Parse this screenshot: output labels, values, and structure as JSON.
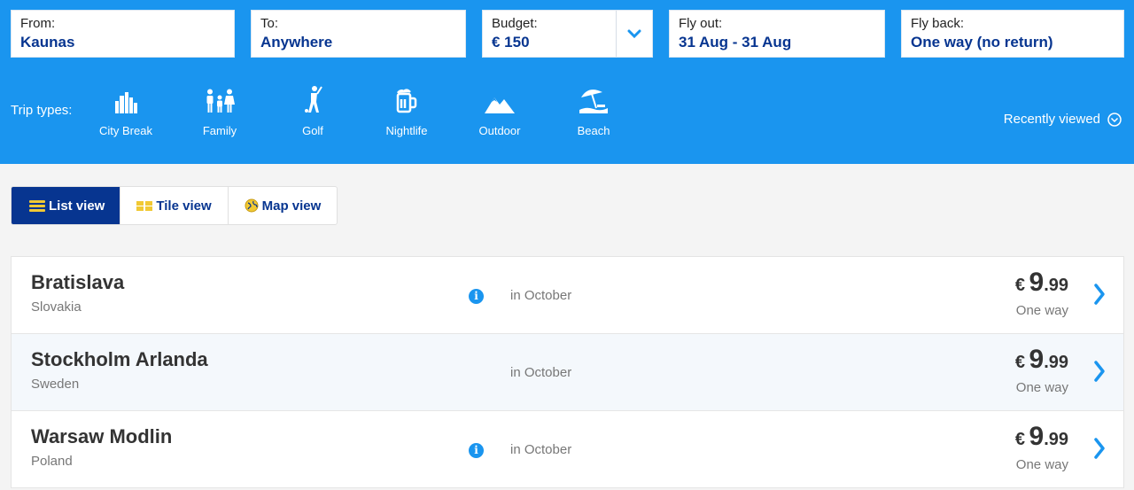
{
  "search": {
    "from": {
      "label": "From:",
      "value": "Kaunas"
    },
    "to": {
      "label": "To:",
      "value": "Anywhere"
    },
    "budget": {
      "label": "Budget:",
      "value": "€ 150"
    },
    "fly_out": {
      "label": "Fly out:",
      "value": "31 Aug - 31 Aug"
    },
    "fly_back": {
      "label": "Fly back:",
      "value": "One way (no return)"
    }
  },
  "trip_types": {
    "label": "Trip types:",
    "items": [
      {
        "label": "City Break",
        "icon": "city-icon"
      },
      {
        "label": "Family",
        "icon": "family-icon"
      },
      {
        "label": "Golf",
        "icon": "golf-icon"
      },
      {
        "label": "Nightlife",
        "icon": "beer-icon"
      },
      {
        "label": "Outdoor",
        "icon": "mountain-icon"
      },
      {
        "label": "Beach",
        "icon": "beach-umbrella-icon"
      }
    ]
  },
  "recently_viewed": "Recently viewed",
  "views": {
    "list": "List view",
    "tile": "Tile view",
    "map": "Map view",
    "active": "list"
  },
  "results": [
    {
      "city": "Bratislava",
      "country": "Slovakia",
      "when": "in October",
      "currency": "€",
      "price_int": "9",
      "price_dec": ".99",
      "trip": "One way",
      "info": true
    },
    {
      "city": "Stockholm Arlanda",
      "country": "Sweden",
      "when": "in October",
      "currency": "€",
      "price_int": "9",
      "price_dec": ".99",
      "trip": "One way",
      "info": false
    },
    {
      "city": "Warsaw Modlin",
      "country": "Poland",
      "when": "in October",
      "currency": "€",
      "price_int": "9",
      "price_dec": ".99",
      "trip": "One way",
      "info": true
    }
  ],
  "colors": {
    "header_blue": "#1a95ef",
    "navy": "#073590",
    "accent_yellow": "#f1c933"
  }
}
